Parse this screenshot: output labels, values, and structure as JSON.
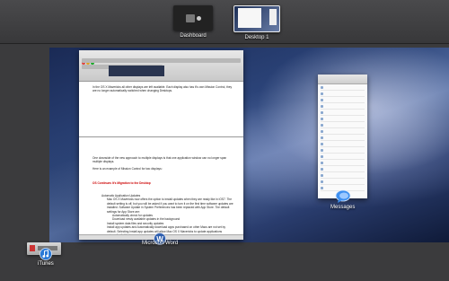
{
  "spaces_bar": {
    "dashboard_label": "Dashboard",
    "desktop1_label": "Desktop 1"
  },
  "apps": {
    "word_label": "Microsoft Word",
    "messages_label": "Messages",
    "itunes_label": "iTunes"
  },
  "document": {
    "intro_para": "In the OS X Mavericks all other displays are left available. Each display also has it's own Mission Control, they are no longer automatically switched when changing Desktops.",
    "downside_para": "One downside of the new approach to multiple displays is that one application window can no longer span multiple displays.",
    "example_para": "Here is an example of Mission Control for two displays:",
    "heading": "OS Continues It's Migration to the Desktop",
    "bullets": [
      "Automatic Application Updates",
      "Mac OS X Mavericks now offers the option to install updates when they are ready like in iOS7. The default setting is off, but you will be asked if you want to turn it on the first time software updates are installed. Software Update in System Preferences has been replaced with App Store. The default settings for App Store are:",
      "Automatically check for updates",
      "Download newly available updates in the background",
      "Install system data files and security updates",
      "Install app updates and Automatically download apps purchased on other Macs are not set by default. Selecting Install app updates will allow Mac OS X Mavericks to update applications automatically like in"
    ]
  },
  "colors": {
    "heading_red": "#cc0000"
  }
}
